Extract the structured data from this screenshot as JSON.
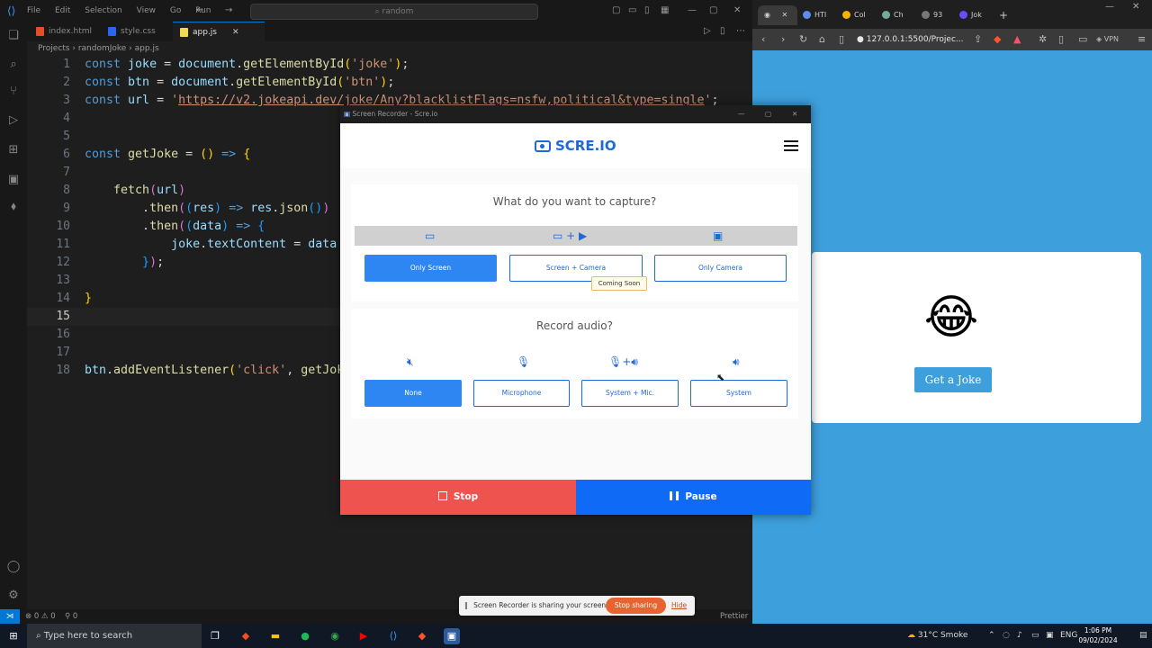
{
  "vscode": {
    "menu": [
      "File",
      "Edit",
      "Selection",
      "View",
      "Go",
      "Run"
    ],
    "search_placeholder": "random",
    "tabs": [
      {
        "label": "index.html",
        "active": false,
        "color": "#e44d26"
      },
      {
        "label": "style.css",
        "active": false,
        "color": "#2965f1"
      },
      {
        "label": "app.js",
        "active": true,
        "color": "#f0db4f"
      }
    ],
    "breadcrumb": [
      "Projects",
      "randomJoke",
      "app.js"
    ],
    "current_line": 15,
    "status_left": [
      "⊗ 0 ⚠ 0",
      "⚲ 0"
    ],
    "status_right": "Prettier"
  },
  "browser": {
    "tabs": [
      "HTI",
      "Col",
      "Ch",
      "93",
      "Jok"
    ],
    "url": "127.0.0.1:5500/Projec...",
    "vpn_label": "VPN",
    "joke_button": "Get a Joke",
    "emoji": "😂"
  },
  "recorder": {
    "window_title": "Screen Recorder - Scre.io",
    "logo": "SCRE.IO",
    "capture_question": "What do you want to capture?",
    "capture_options": [
      "Only Screen",
      "Screen + Camera",
      "Only Camera"
    ],
    "capture_selected": "Only Screen",
    "coming_soon": "Coming Soon",
    "audio_question": "Record audio?",
    "audio_options": [
      "None",
      "Microphone",
      "System + Mic.",
      "System"
    ],
    "audio_selected": "None",
    "stop_label": "Stop",
    "pause_label": "Pause"
  },
  "sharing_bar": {
    "message": "Screen Recorder is sharing your screen.",
    "stop_label": "Stop sharing",
    "hide_label": "Hide"
  },
  "taskbar": {
    "search_placeholder": "Type here to search",
    "weather": "31°C  Smoke",
    "language": "ENG",
    "time": "1:06 PM",
    "date": "09/02/2024"
  }
}
